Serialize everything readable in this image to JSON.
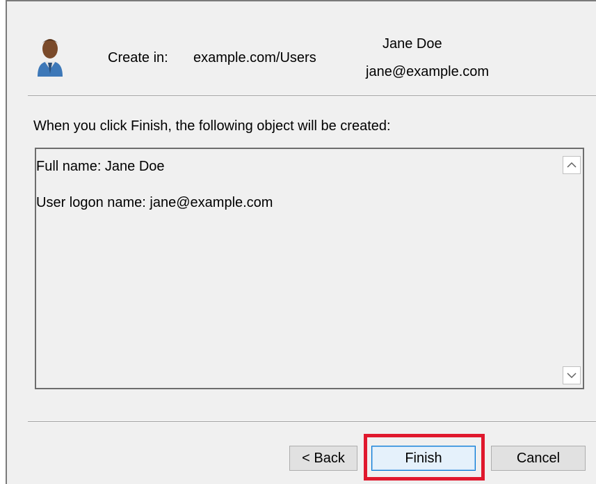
{
  "header": {
    "create_in_label": "Create in:",
    "create_in_path": "example.com/Users",
    "user_name": "Jane Doe",
    "user_email": "jane@example.com"
  },
  "instruction": "When you click Finish, the following object will be created:",
  "summary": {
    "lines": [
      "Full name: Jane Doe",
      "User logon name: jane@example.com"
    ]
  },
  "buttons": {
    "back": "< Back",
    "finish": "Finish",
    "cancel": "Cancel"
  },
  "icons": {
    "user": "user-icon",
    "scroll_up": "chevron-up-icon",
    "scroll_down": "chevron-down-icon"
  },
  "colors": {
    "highlight": "#e0182d",
    "dialog_bg": "#f0f0f0"
  }
}
